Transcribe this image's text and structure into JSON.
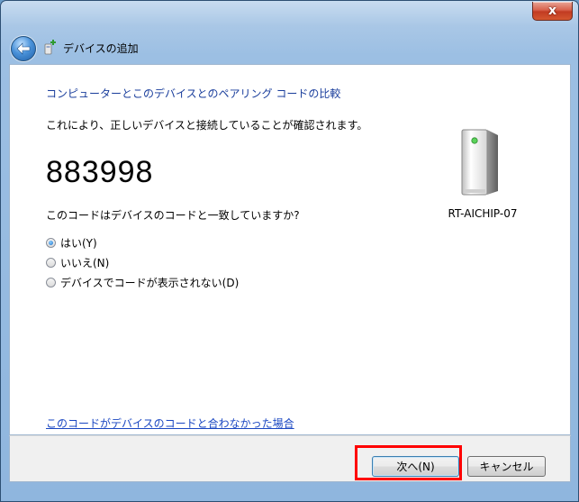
{
  "window": {
    "close_label": "x",
    "title": "デバイスの追加"
  },
  "main": {
    "heading": "コンピューターとこのデバイスとのペアリング コードの比較",
    "description": "これにより、正しいデバイスと接続していることが確認されます。",
    "pairing_code": "883998",
    "question": "このコードはデバイスのコードと一致していますか?",
    "options": [
      {
        "label": "はい(Y)",
        "checked": true
      },
      {
        "label": "いいえ(N)",
        "checked": false
      },
      {
        "label": "デバイスでコードが表示されない(D)",
        "checked": false
      }
    ],
    "device_name": "RT-AICHIP-07",
    "mismatch_link": "このコードがデバイスのコードと合わなかった場合"
  },
  "footer": {
    "next_label": "次へ(N)",
    "cancel_label": "キャンセル"
  },
  "icons": {
    "back": "back-arrow-icon",
    "title": "bluetooth-add-device-icon",
    "device": "device-tower-icon"
  },
  "colors": {
    "heading": "#1a3e9c",
    "link": "#1a47c2",
    "highlight": "#ff0000"
  }
}
